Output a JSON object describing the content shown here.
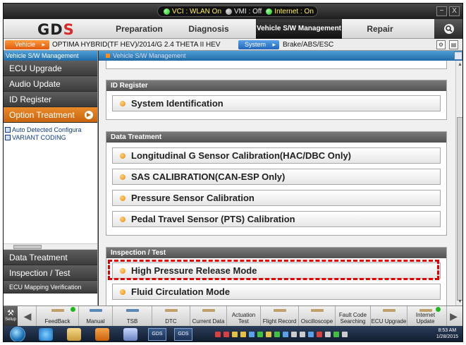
{
  "status": {
    "vci": "VCI : WLAN On",
    "vmi": "VMI : Off",
    "internet": "Internet : On"
  },
  "window_controls": {
    "minimize": "−",
    "close": "X"
  },
  "logo": {
    "text": "GD",
    "mark": "S"
  },
  "nav": {
    "tabs": [
      {
        "label": "Preparation"
      },
      {
        "label": "Diagnosis"
      },
      {
        "label": "Vehicle S/W Management"
      },
      {
        "label": "Repair"
      }
    ]
  },
  "vehicle_bar": {
    "vehicle_button": "Vehicle",
    "vehicle_text": "OPTIMA HYBRID(TF HEV)/2014/G 2.4 THETA II HEV",
    "system_button": "System",
    "system_text": "Brake/ABS/ESC"
  },
  "sidebar": {
    "title": "Vehicle S/W Management",
    "items_top": [
      {
        "label": "ECU Upgrade"
      },
      {
        "label": "Audio Update"
      },
      {
        "label": "ID Register"
      },
      {
        "label": "Option Treatment"
      }
    ],
    "tree": [
      {
        "label": "Auto Detected Configura"
      },
      {
        "label": "VARIANT CODING"
      }
    ],
    "items_bottom": [
      {
        "label": "Data Treatment"
      },
      {
        "label": "Inspection / Test"
      },
      {
        "label": "ECU Mapping Verification"
      }
    ]
  },
  "content": {
    "breadcrumb": "Vehicle S/W Management",
    "sections": [
      {
        "title": "ID Register",
        "items": [
          "System Identification"
        ]
      },
      {
        "title": "Data Treatment",
        "items": [
          "Longitudinal G Sensor Calibration(HAC/DBC Only)",
          "SAS CALIBRATION(CAN-ESP Only)",
          "Pressure Sensor Calibration",
          "Pedal Travel Sensor (PTS) Calibration"
        ]
      },
      {
        "title": "Inspection / Test",
        "items": [
          "High Pressure Release Mode",
          "Fluid Circulation Mode"
        ]
      }
    ]
  },
  "toolbar": {
    "setup": "Setup",
    "buttons": [
      "FeedBack",
      "Manual",
      "TSB",
      "DTC",
      "Current Data",
      "Actuation Test",
      "Flight Record",
      "Oscilloscope",
      "Fault Code Searching",
      "ECU Upgrade",
      "Internet Update"
    ]
  },
  "taskbar": {
    "apps": [
      "GDS",
      "GDS"
    ],
    "time": "8:53 AM",
    "date": "1/28/2015"
  },
  "colors": {
    "accent_orange": "#e98a2a",
    "header_blue": "#1f6aa6",
    "highlight_red": "#e00000"
  }
}
